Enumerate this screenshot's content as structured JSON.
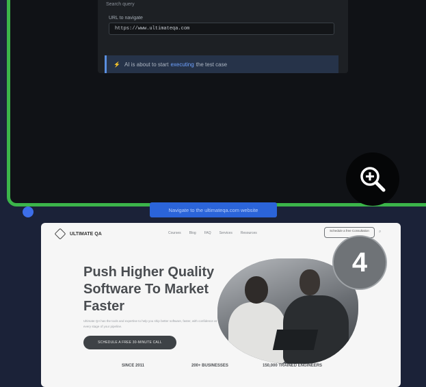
{
  "step_card": {
    "panel_heading": "Search query",
    "url_label": "URL to navigate",
    "url_value": "https://www.ultimateqa.com",
    "status_prefix": "AI is about to start",
    "status_highlight": "executing",
    "status_suffix": "the test case",
    "action_button": "Navigate to the ultimateqa.com website",
    "icons": {
      "zoom": "zoom-in-icon",
      "info": "info-icon",
      "status": "lightning-icon"
    }
  },
  "site_preview": {
    "logo": "ULTIMATE QA",
    "nav_links": [
      "Courses",
      "Blog",
      "FAQ",
      "Services",
      "Resources"
    ],
    "nav_cta": "Schedule a free Consultation",
    "hero_title": "Push Higher Quality Software To Market Faster",
    "hero_subtitle": "Ultimate QA has the tools and expertise to help you ship better software, faster, with confidence at every stage of your pipeline.",
    "hero_button": "SCHEDULE A FREE 30-MINUTE CALL",
    "stats": [
      "SINCE 2011",
      "200+ BUSINESSES",
      "150,000 TRAINED ENGINEERS"
    ]
  },
  "badge": {
    "number": "4"
  },
  "colors": {
    "accent_green": "#3bb54a",
    "accent_blue": "#2b64d9",
    "background": "#1b2238"
  }
}
